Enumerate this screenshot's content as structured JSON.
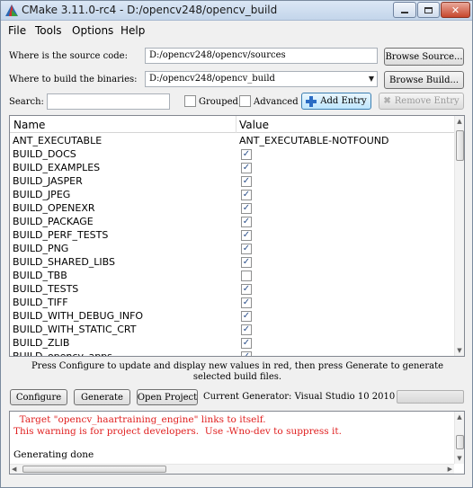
{
  "window": {
    "title": "CMake 3.11.0-rc4 - D:/opencv248/opencv_build"
  },
  "menu": {
    "file": "File",
    "tools": "Tools",
    "options": "Options",
    "help": "Help"
  },
  "source": {
    "label": "Where is the source code:",
    "value": "D:/opencv248/opencv/sources",
    "browse_label": "Browse Source..."
  },
  "build": {
    "label": "Where to build the binaries:",
    "value": "D:/opencv248/opencv_build",
    "browse_label": "Browse Build..."
  },
  "search": {
    "label": "Search:",
    "value": "",
    "grouped_label": "Grouped",
    "grouped_checked": false,
    "advanced_label": "Advanced",
    "advanced_checked": false,
    "add_entry_label": "Add Entry",
    "remove_entry_label": "Remove Entry"
  },
  "table": {
    "col_name": "Name",
    "col_value": "Value",
    "rows": [
      {
        "name": "ANT_EXECUTABLE",
        "type": "text",
        "value": "ANT_EXECUTABLE-NOTFOUND"
      },
      {
        "name": "BUILD_DOCS",
        "type": "bool",
        "checked": true
      },
      {
        "name": "BUILD_EXAMPLES",
        "type": "bool",
        "checked": true
      },
      {
        "name": "BUILD_JASPER",
        "type": "bool",
        "checked": true
      },
      {
        "name": "BUILD_JPEG",
        "type": "bool",
        "checked": true
      },
      {
        "name": "BUILD_OPENEXR",
        "type": "bool",
        "checked": true
      },
      {
        "name": "BUILD_PACKAGE",
        "type": "bool",
        "checked": true
      },
      {
        "name": "BUILD_PERF_TESTS",
        "type": "bool",
        "checked": true
      },
      {
        "name": "BUILD_PNG",
        "type": "bool",
        "checked": true
      },
      {
        "name": "BUILD_SHARED_LIBS",
        "type": "bool",
        "checked": true
      },
      {
        "name": "BUILD_TBB",
        "type": "bool",
        "checked": false
      },
      {
        "name": "BUILD_TESTS",
        "type": "bool",
        "checked": true
      },
      {
        "name": "BUILD_TIFF",
        "type": "bool",
        "checked": true
      },
      {
        "name": "BUILD_WITH_DEBUG_INFO",
        "type": "bool",
        "checked": true
      },
      {
        "name": "BUILD_WITH_STATIC_CRT",
        "type": "bool",
        "checked": true
      },
      {
        "name": "BUILD_ZLIB",
        "type": "bool",
        "checked": true
      },
      {
        "name": "BUILD_opencv_apps",
        "type": "bool",
        "checked": true
      }
    ]
  },
  "hint": {
    "line1": "Press Configure to update and display new values in red, then press Generate to generate",
    "line2": "selected build files."
  },
  "actions": {
    "configure_label": "Configure",
    "generate_label": "Generate",
    "open_project_label": "Open Project",
    "current_generator": "Current Generator: Visual Studio 10 2010"
  },
  "output": {
    "lines": [
      {
        "text": "  Target \"opencv_haartraining_engine\" links to itself.",
        "color": "red"
      },
      {
        "text": "This warning is for project developers.  Use -Wno-dev to suppress it.",
        "color": "red"
      },
      {
        "text": "",
        "color": "black"
      },
      {
        "text": "Generating done",
        "color": "black"
      }
    ]
  },
  "colors": {
    "error_text": "#e02020",
    "check_mark": "#2b4f8a"
  }
}
